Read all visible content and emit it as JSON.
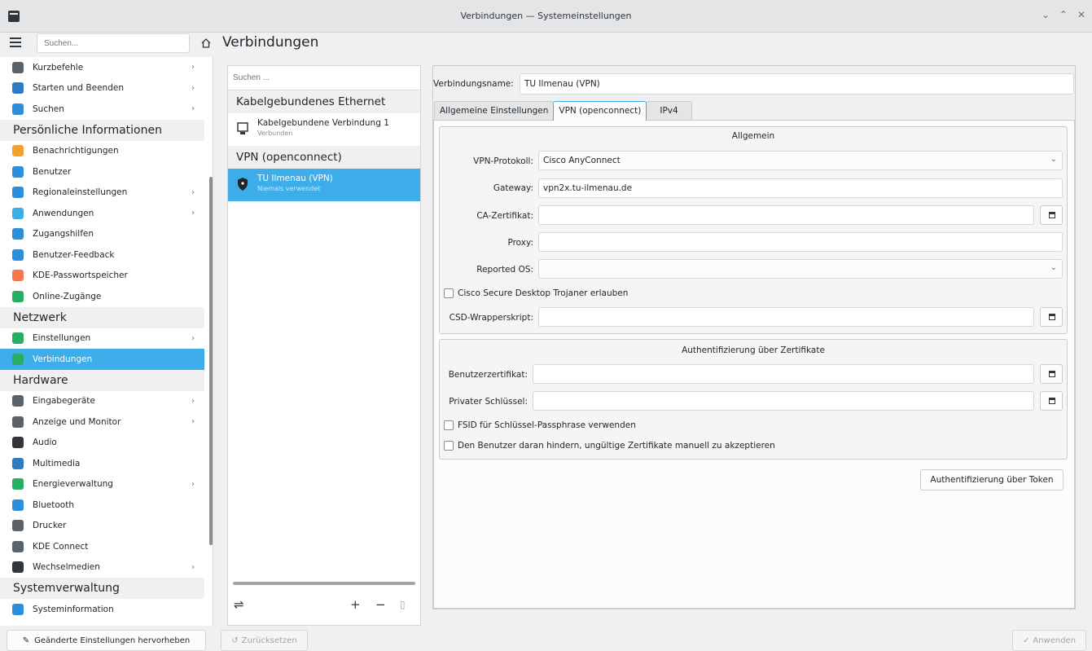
{
  "window": {
    "title": "Verbindungen — Systemeinstellungen",
    "controls": [
      "⌄",
      "⌃",
      "✕"
    ]
  },
  "toolbar": {
    "search_placeholder": "Suchen...",
    "page_title": "Verbindungen"
  },
  "sidebar": {
    "rows": [
      {
        "type": "item",
        "label": "Kurzbefehle",
        "chevron": true,
        "icon": "keyboard-icon",
        "color": "#5b6268"
      },
      {
        "type": "item",
        "label": "Starten und Beenden",
        "chevron": true,
        "icon": "monitor-icon",
        "color": "#2d7bc3"
      },
      {
        "type": "item",
        "label": "Suchen",
        "chevron": true,
        "icon": "search-icon",
        "color": "#2d8fd9"
      },
      {
        "type": "cat",
        "label": "Persönliche Informationen"
      },
      {
        "type": "item",
        "label": "Benachrichtigungen",
        "chevron": false,
        "icon": "bell-icon",
        "color": "#f4a12b"
      },
      {
        "type": "item",
        "label": "Benutzer",
        "chevron": false,
        "icon": "user-icon",
        "color": "#2d8fd9"
      },
      {
        "type": "item",
        "label": "Regionaleinstellungen",
        "chevron": true,
        "icon": "flag-icon",
        "color": "#2d8fd9"
      },
      {
        "type": "item",
        "label": "Anwendungen",
        "chevron": true,
        "icon": "apps-icon",
        "color": "#3daee9"
      },
      {
        "type": "item",
        "label": "Zugangshilfen",
        "chevron": false,
        "icon": "accessibility-icon",
        "color": "#2d8fd9"
      },
      {
        "type": "item",
        "label": "Benutzer-Feedback",
        "chevron": false,
        "icon": "feedback-icon",
        "color": "#2d8fd9"
      },
      {
        "type": "item",
        "label": "KDE-Passwortspeicher",
        "chevron": false,
        "icon": "wallet-icon",
        "color": "#f47750"
      },
      {
        "type": "item",
        "label": "Online-Zugänge",
        "chevron": false,
        "icon": "globe-icon",
        "color": "#27ae60"
      },
      {
        "type": "cat",
        "label": "Netzwerk"
      },
      {
        "type": "item",
        "label": "Einstellungen",
        "chevron": true,
        "icon": "globe-icon",
        "color": "#27ae60"
      },
      {
        "type": "item",
        "label": "Verbindungen",
        "chevron": false,
        "icon": "network-icon",
        "color": "#27ae60",
        "selected": true
      },
      {
        "type": "cat",
        "label": "Hardware"
      },
      {
        "type": "item",
        "label": "Eingabegeräte",
        "chevron": true,
        "icon": "input-device-icon",
        "color": "#5b6268"
      },
      {
        "type": "item",
        "label": "Anzeige und Monitor",
        "chevron": true,
        "icon": "display-icon",
        "color": "#5b6268"
      },
      {
        "type": "item",
        "label": "Audio",
        "chevron": false,
        "icon": "speaker-icon",
        "color": "#31363b"
      },
      {
        "type": "item",
        "label": "Multimedia",
        "chevron": false,
        "icon": "multimedia-icon",
        "color": "#2d7bc3"
      },
      {
        "type": "item",
        "label": "Energieverwaltung",
        "chevron": true,
        "icon": "battery-icon",
        "color": "#27ae60"
      },
      {
        "type": "item",
        "label": "Bluetooth",
        "chevron": false,
        "icon": "bluetooth-icon",
        "color": "#2d8fd9"
      },
      {
        "type": "item",
        "label": "Drucker",
        "chevron": false,
        "icon": "printer-icon",
        "color": "#5b6268"
      },
      {
        "type": "item",
        "label": "KDE Connect",
        "chevron": false,
        "icon": "phone-icon",
        "color": "#5b6268"
      },
      {
        "type": "item",
        "label": "Wechselmedien",
        "chevron": true,
        "icon": "usb-icon",
        "color": "#31363b"
      },
      {
        "type": "cat",
        "label": "Systemverwaltung"
      },
      {
        "type": "item",
        "label": "Systeminformation",
        "chevron": false,
        "icon": "info-icon",
        "color": "#2d8fd9"
      }
    ],
    "highlight_button": "Geänderte Einstellungen hervorheben"
  },
  "connections": {
    "search_placeholder": "Suchen ...",
    "categories": [
      {
        "label": "Kabelgebundenes Ethernet",
        "items": [
          {
            "name": "Kabelgebundene Verbindung 1",
            "status": "Verbunden",
            "icon": "wired-network-icon"
          }
        ]
      },
      {
        "label": "VPN (openconnect)",
        "items": [
          {
            "name": "TU Ilmenau (VPN)",
            "status": "Niemals verwendet",
            "icon": "vpn-shield-icon",
            "selected": true
          }
        ]
      }
    ],
    "actions": {
      "configure": "⇌",
      "add": "+",
      "remove": "−",
      "export": "▯"
    }
  },
  "details": {
    "name_label": "Verbindungsname:",
    "name_value": "TU Ilmenau (VPN)",
    "tabs": [
      "Allgemeine Einstellungen",
      "VPN (openconnect)",
      "IPv4"
    ],
    "active_tab": 1,
    "general": {
      "title": "Allgemein",
      "protocol_label": "VPN-Protokoll:",
      "protocol_value": "Cisco AnyConnect",
      "gateway_label": "Gateway:",
      "gateway_value": "vpn2x.tu-ilmenau.de",
      "ca_label": "CA-Zertifikat:",
      "ca_value": "",
      "proxy_label": "Proxy:",
      "proxy_value": "",
      "os_label": "Reported OS:",
      "os_value": "",
      "csd_checkbox": "Cisco Secure Desktop Trojaner erlauben",
      "csd_checked": false,
      "wrapper_label": "CSD-Wrapperskript:",
      "wrapper_value": ""
    },
    "certs": {
      "title": "Authentifizierung über Zertifikate",
      "user_cert_label": "Benutzerzertifikat:",
      "user_cert_value": "",
      "private_key_label": "Privater Schlüssel:",
      "private_key_value": "",
      "fsid_checkbox": "FSID für Schlüssel-Passphrase verwenden",
      "fsid_checked": false,
      "prevent_checkbox": "Den Benutzer daran hindern, ungültige Zertifikate manuell zu akzeptieren",
      "prevent_checked": false
    },
    "token_button": "Authentifizierung über Token"
  },
  "footer": {
    "reset": "Zurücksetzen",
    "apply": "Anwenden"
  }
}
